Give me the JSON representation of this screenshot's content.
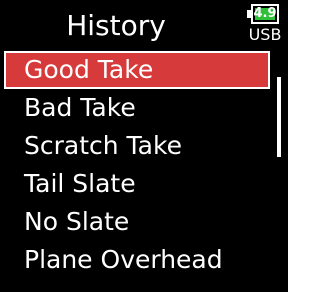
{
  "header": {
    "title": "History",
    "battery": {
      "voltage": "4.9",
      "source": "USB",
      "level_fraction": 1.0,
      "fill_color": "#2fbf3a"
    }
  },
  "list": {
    "items": [
      {
        "label": "Good Take",
        "selected": true
      },
      {
        "label": "Bad Take",
        "selected": false
      },
      {
        "label": "Scratch Take",
        "selected": false
      },
      {
        "label": "Tail Slate",
        "selected": false
      },
      {
        "label": "No Slate",
        "selected": false
      },
      {
        "label": "Plane Overhead",
        "selected": false
      }
    ]
  },
  "colors": {
    "background": "#000000",
    "selection": "#d63a3a",
    "text": "#ffffff"
  }
}
